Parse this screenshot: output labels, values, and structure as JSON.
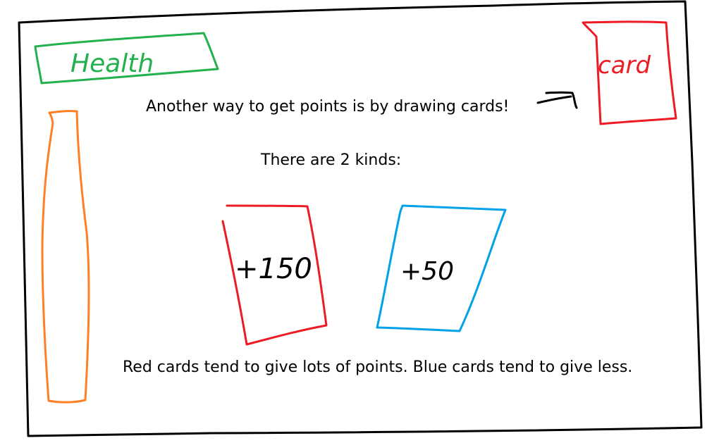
{
  "colors": {
    "frame": "#000000",
    "health": "#22b14c",
    "health_bar": "#ff7f27",
    "red_card": "#ed1c24",
    "blue_card": "#00a2e8",
    "text": "#000000"
  },
  "health_label": {
    "text": "Health",
    "icon": "health-label-box"
  },
  "health_bar": {
    "icon": "health-bar-empty"
  },
  "deck_card": {
    "label": "card",
    "icon": "red-card-outline"
  },
  "arrow": {
    "icon": "arrow-right-icon"
  },
  "instructions": {
    "line1": "Another way to get points is by drawing cards!",
    "line2": "There are 2 kinds:",
    "line3": "Red cards tend to give lots of points. Blue cards tend to give less."
  },
  "cards": [
    {
      "kind": "red",
      "value": "+150"
    },
    {
      "kind": "blue",
      "value": "+50"
    }
  ]
}
